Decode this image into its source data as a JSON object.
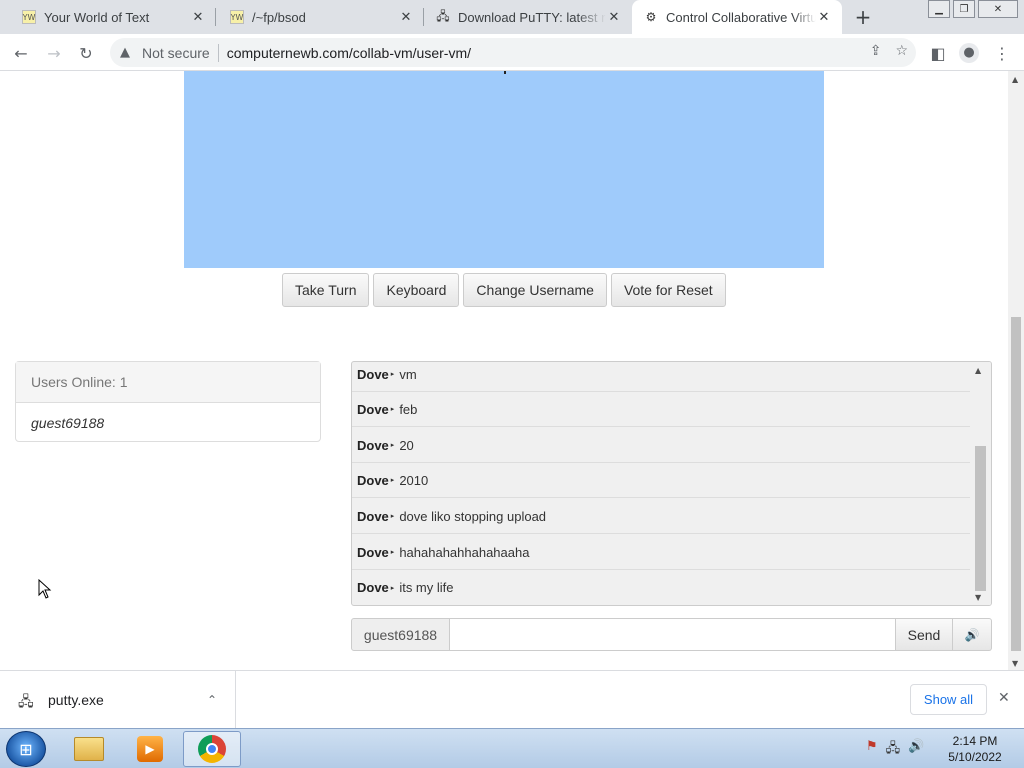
{
  "browser": {
    "tabs": [
      {
        "label": "Your World of Text",
        "favicon": "ywot-icon"
      },
      {
        "label": "/~fp/bsod",
        "favicon": "ywot-icon"
      },
      {
        "label": "Download PuTTY: latest release",
        "favicon": "putty-icon"
      },
      {
        "label": "Control Collaborative Virtual Machines",
        "favicon": "collabvm-icon",
        "active": true
      }
    ],
    "address": {
      "security_label": "Not secure",
      "url": "computernewb.com/collab-vm/user-vm/"
    }
  },
  "vm": {
    "screen_color": "#9fcbfb",
    "buttons": {
      "take_turn": "Take Turn",
      "keyboard": "Keyboard",
      "change_username": "Change Username",
      "vote_reset": "Vote for Reset"
    }
  },
  "users": {
    "header": "Users Online: 1",
    "list": [
      "guest69188"
    ]
  },
  "chat": {
    "messages": [
      {
        "nick": "Dove",
        "text": "vm"
      },
      {
        "nick": "Dove",
        "text": "feb"
      },
      {
        "nick": "Dove",
        "text": "20"
      },
      {
        "nick": "Dove",
        "text": "2010"
      },
      {
        "nick": "Dove",
        "text": "dove liko stopping upload"
      },
      {
        "nick": "Dove",
        "text": "hahahahahhahahaaha"
      },
      {
        "nick": "Dove",
        "text": "its my life"
      }
    ],
    "input": {
      "nickname": "guest69188",
      "value": "",
      "send_label": "Send"
    }
  },
  "downloads": {
    "file": "putty.exe",
    "show_all": "Show all"
  },
  "taskbar": {
    "time": "2:14 PM",
    "date": "5/10/2022"
  },
  "colors": {
    "accent": "#1a73e8",
    "vm_screen": "#9fcbfb"
  }
}
